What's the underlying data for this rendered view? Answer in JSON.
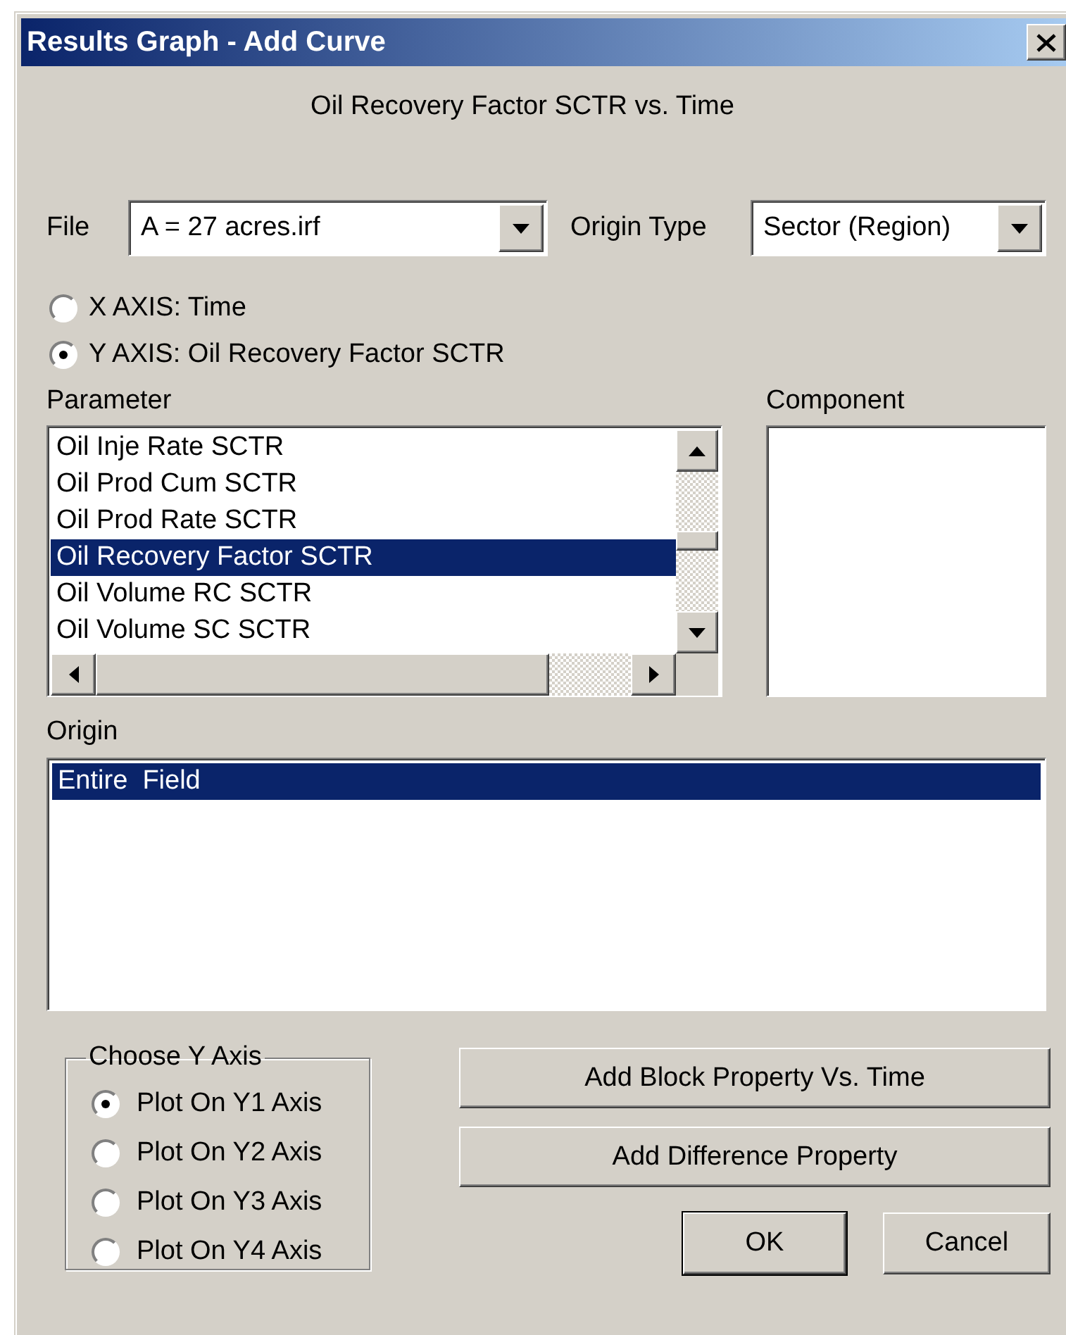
{
  "window": {
    "title": "Results Graph - Add Curve"
  },
  "subtitle": "Oil Recovery Factor SCTR vs. Time",
  "file": {
    "label": "File",
    "value": "A = 27 acres.irf"
  },
  "origin_type": {
    "label": "Origin Type",
    "value": "Sector (Region)"
  },
  "axes": [
    {
      "label": "X AXIS: Time",
      "selected": false
    },
    {
      "label": "Y AXIS: Oil Recovery Factor SCTR",
      "selected": true
    }
  ],
  "parameter": {
    "label": "Parameter",
    "items": [
      {
        "text": "Oil Inje Rate SCTR",
        "selected": false
      },
      {
        "text": "Oil Prod Cum SCTR",
        "selected": false
      },
      {
        "text": "Oil Prod Rate SCTR",
        "selected": false
      },
      {
        "text": "Oil Recovery Factor SCTR",
        "selected": true
      },
      {
        "text": "Oil Volume RC SCTR",
        "selected": false
      },
      {
        "text": "Oil Volume SC SCTR",
        "selected": false
      }
    ]
  },
  "component": {
    "label": "Component"
  },
  "origin": {
    "label": "Origin",
    "items": [
      {
        "text": "Entire  Field",
        "selected": true
      }
    ]
  },
  "y_axis": {
    "title": "Choose Y Axis",
    "options": [
      {
        "label": "Plot On Y1 Axis",
        "selected": true
      },
      {
        "label": "Plot On Y2 Axis",
        "selected": false
      },
      {
        "label": "Plot On Y3 Axis",
        "selected": false
      },
      {
        "label": "Plot On Y4 Axis",
        "selected": false
      }
    ]
  },
  "buttons": [
    {
      "label": "Add Block Property Vs. Time"
    },
    {
      "label": "Add Difference Property"
    }
  ],
  "ok": "OK",
  "cancel": "Cancel"
}
